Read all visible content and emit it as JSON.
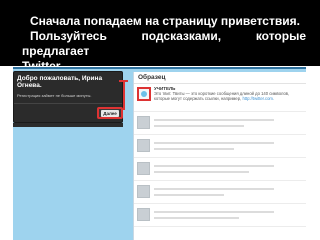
{
  "slide": {
    "line1": "Сначала попадаем на страницу приветствия.",
    "line2": "Пользуйтесь подсказками, которые предлагает",
    "line3": "Twitter."
  },
  "welcome": {
    "title": "Добро пожаловать, Ирина Огнева.",
    "subtitle": "Регистрация займет не больше минуты.",
    "next_label": "Далее"
  },
  "panel": {
    "title": "Образец",
    "first_tweet": {
      "user": "УЧИТЕЛЬ",
      "text": "Это твит. Твиты — это короткие сообщения длиной до 140 символов, которые могут содержать ссылки, например,",
      "link": "http://twitter.com."
    }
  },
  "colors": {
    "header_bg": "#000000",
    "accent_red": "#dd3333",
    "twitter_blue": "#9ed3ee"
  }
}
